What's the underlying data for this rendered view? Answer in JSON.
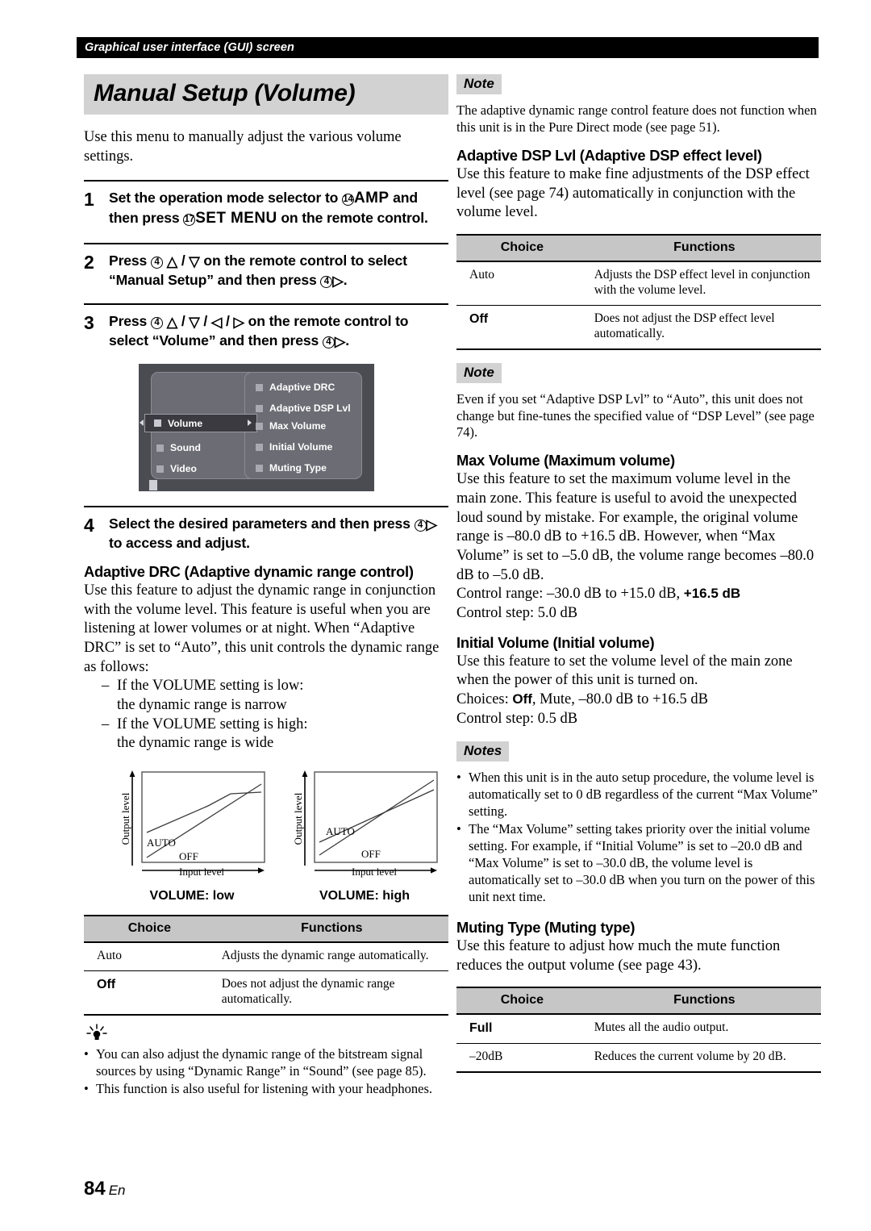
{
  "running_header": "Graphical user interface (GUI) screen",
  "page_title": "Manual Setup (Volume)",
  "intro": "Use this menu to manually adjust the various volume settings.",
  "steps": [
    {
      "num": "1",
      "seg": [
        {
          "t": "Set the operation mode selector to "
        },
        {
          "circle": "14"
        },
        {
          "big": "AMP"
        },
        {
          "t": " and then press "
        },
        {
          "circle": "17"
        },
        {
          "big": "SET MENU"
        },
        {
          "t": " on the remote control."
        }
      ]
    },
    {
      "num": "2",
      "seg": [
        {
          "t": "Press "
        },
        {
          "circle": "4"
        },
        {
          "t": " "
        },
        {
          "arrow": "up"
        },
        {
          "t": " / "
        },
        {
          "arrow": "down"
        },
        {
          "t": " on the remote control to select “Manual Setup” and then press "
        },
        {
          "circle": "4"
        },
        {
          "arrow": "right"
        },
        {
          "t": "."
        }
      ]
    },
    {
      "num": "3",
      "seg": [
        {
          "t": "Press "
        },
        {
          "circle": "4"
        },
        {
          "t": " "
        },
        {
          "arrow": "up"
        },
        {
          "t": " / "
        },
        {
          "arrow": "down"
        },
        {
          "t": " / "
        },
        {
          "arrow": "left"
        },
        {
          "t": " / "
        },
        {
          "arrow": "right"
        },
        {
          "t": " on the remote control to select “Volume” and then press "
        },
        {
          "circle": "4"
        },
        {
          "arrow": "right"
        },
        {
          "t": "."
        }
      ]
    },
    {
      "num": "4",
      "seg": [
        {
          "t": "Select the desired parameters and then press "
        },
        {
          "circle": "4"
        },
        {
          "arrow": "right"
        },
        {
          "t": " to access and adjust."
        }
      ]
    }
  ],
  "gui": {
    "selected_item": "Volume",
    "left_items": [
      "Sound",
      "Video"
    ],
    "right_items": [
      "Adaptive DRC",
      "Adaptive DSP Lvl",
      "Max Volume",
      "Initial Volume",
      "Muting Type"
    ],
    "colors": {
      "screen_bg": "#4b4b52",
      "panel_bg": "#6c6c74",
      "panel_border": "#8b8b93",
      "highlight_bg": "#3a3a40",
      "text": "#ffffff"
    }
  },
  "adaptive_drc": {
    "heading": "Adaptive DRC (Adaptive dynamic range control)",
    "body": "Use this feature to adjust the dynamic range in conjunction with the volume level. This feature is useful when you are listening at lower volumes or at night. When “Adaptive DRC” is set to “Auto”, this unit controls the dynamic range as follows:",
    "list": [
      "If the VOLUME setting is low:",
      "the dynamic range is narrow",
      "If the VOLUME setting is high:",
      "the dynamic range is wide"
    ],
    "table": {
      "headers": [
        "Choice",
        "Functions"
      ],
      "rows": [
        {
          "choice": "Auto",
          "bold": false,
          "function": "Adjusts the dynamic range automatically."
        },
        {
          "choice": "Off",
          "bold": true,
          "function": "Does not adjust the dynamic range automatically."
        }
      ]
    },
    "tips": [
      "You can also adjust the dynamic range of the bitstream signal sources by using “Dynamic Range” in “Sound” (see page 85).",
      "This function is also useful for listening with your headphones."
    ]
  },
  "chart_data": [
    {
      "type": "line",
      "title": "VOLUME: low",
      "xlabel": "Input level",
      "ylabel": "Output level",
      "grid": false,
      "series": [
        {
          "name": "AUTO",
          "points": [
            [
              0.04,
              0.33
            ],
            [
              0.54,
              0.64
            ],
            [
              0.72,
              0.77
            ],
            [
              1.0,
              0.79
            ]
          ]
        },
        {
          "name": "OFF",
          "points": [
            [
              0.04,
              0.06
            ],
            [
              1.0,
              0.88
            ]
          ]
        }
      ]
    },
    {
      "type": "line",
      "title": "VOLUME: high",
      "xlabel": "Input level",
      "ylabel": "Output level",
      "grid": false,
      "series": [
        {
          "name": "AUTO",
          "points": [
            [
              0.04,
              0.22
            ],
            [
              1.0,
              0.8
            ]
          ]
        },
        {
          "name": "OFF",
          "points": [
            [
              0.04,
              0.08
            ],
            [
              1.0,
              0.9
            ]
          ]
        }
      ]
    }
  ],
  "right": {
    "note1_tag": "Note",
    "note1_body": "The adaptive dynamic range control feature does not function when this unit is in the Pure Direct mode (see page 51).",
    "adaptive_dsp": {
      "heading": "Adaptive DSP Lvl (Adaptive DSP effect level)",
      "body": "Use this feature to make fine adjustments of the DSP effect level (see page 74) automatically in conjunction with the volume level.",
      "table": {
        "headers": [
          "Choice",
          "Functions"
        ],
        "rows": [
          {
            "choice": "Auto",
            "bold": false,
            "function": "Adjusts the DSP effect level in conjunction with the volume level."
          },
          {
            "choice": "Off",
            "bold": true,
            "function": "Does not adjust the DSP effect level automatically."
          }
        ]
      }
    },
    "note2_tag": "Note",
    "note2_body": "Even if you set “Adaptive DSP Lvl” to “Auto”, this unit does not change but fine-tunes the specified value of “DSP Level” (see page 74).",
    "max_volume": {
      "heading": "Max Volume (Maximum volume)",
      "body": "Use this feature to set the maximum volume level in the main zone. This feature is useful to avoid the unexpected loud sound by mistake. For example, the original volume range is –80.0 dB to +16.5 dB. However, when “Max Volume” is set to –5.0 dB, the volume range becomes –80.0 dB to –5.0 dB.",
      "control_range_label": "Control range: –30.0 dB to +15.0 dB, ",
      "control_range_bold": "+16.5 dB",
      "control_step": "Control step: 5.0 dB"
    },
    "initial_volume": {
      "heading": "Initial Volume (Initial volume)",
      "body": "Use this feature to set the volume level of the main zone when the power of this unit is turned on.",
      "choices_label": "Choices: ",
      "choices_bold": "Off",
      "choices_rest": ", Mute, –80.0 dB to +16.5 dB",
      "control_step": "Control step: 0.5 dB"
    },
    "notes_tag": "Notes",
    "notes": [
      "When this unit is in the auto setup procedure, the volume level is automatically set to 0 dB regardless of the current “Max Volume” setting.",
      "The “Max Volume” setting takes priority over the initial volume setting. For example, if “Initial Volume” is set to –20.0 dB and “Max Volume” is set to –30.0 dB, the volume level is automatically set to –30.0 dB when you turn on the power of this unit next time."
    ],
    "muting_type": {
      "heading": "Muting Type (Muting type)",
      "body": "Use this feature to adjust how much the mute function reduces the output volume (see page 43).",
      "table": {
        "headers": [
          "Choice",
          "Functions"
        ],
        "rows": [
          {
            "choice": "Full",
            "bold": true,
            "function": "Mutes all the audio output."
          },
          {
            "choice": "–20dB",
            "bold": false,
            "function": "Reduces the current volume by 20 dB."
          }
        ]
      }
    }
  },
  "footer": {
    "page_number": "84",
    "language": "En"
  }
}
